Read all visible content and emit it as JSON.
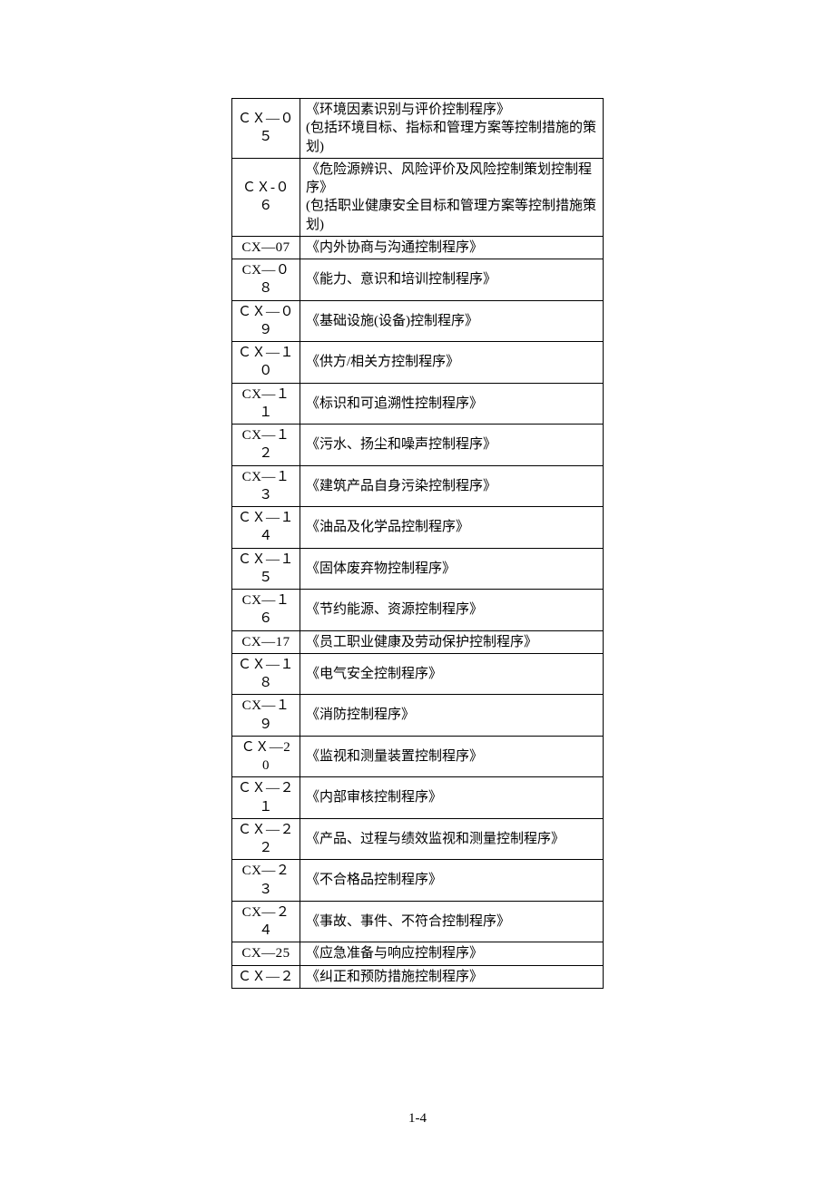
{
  "rows": [
    {
      "code": "ＣＸ—０５",
      "desc": "《环境因素识别与评价控制程序》\n(包括环境目标、指标和管理方案等控制措施的策划)"
    },
    {
      "code": "ＣＸ-０６",
      "desc": "《危险源辨识、风险评价及风险控制策划控制程序》\n(包括职业健康安全目标和管理方案等控制措施策划)"
    },
    {
      "code": "CX—07",
      "desc": "《内外协商与沟通控制程序》"
    },
    {
      "code": "CX—０８",
      "desc": "《能力、意识和培训控制程序》"
    },
    {
      "code": "ＣＸ—０９",
      "desc": "《基础设施(设备)控制程序》"
    },
    {
      "code": "ＣＸ—１０",
      "desc": "《供方/相关方控制程序》"
    },
    {
      "code": "CX—１１",
      "desc": "《标识和可追溯性控制程序》"
    },
    {
      "code": "CX—１２",
      "desc": "《污水、扬尘和噪声控制程序》"
    },
    {
      "code": "CX—１３",
      "desc": "《建筑产品自身污染控制程序》"
    },
    {
      "code": "ＣＸ—１４",
      "desc": "《油品及化学品控制程序》"
    },
    {
      "code": "ＣＸ—１５",
      "desc": "《固体废弃物控制程序》"
    },
    {
      "code": "CX—１６",
      "desc": "《节约能源、资源控制程序》"
    },
    {
      "code": "CX—17",
      "desc": "《员工职业健康及劳动保护控制程序》"
    },
    {
      "code": "ＣＸ—１８",
      "desc": "《电气安全控制程序》"
    },
    {
      "code": "CX—１９",
      "desc": "《消防控制程序》"
    },
    {
      "code": "ＣＸ—20",
      "desc": "《监视和测量装置控制程序》"
    },
    {
      "code": "ＣＸ—２１",
      "desc": "《内部审核控制程序》"
    },
    {
      "code": "ＣＸ—２２",
      "desc": "《产品、过程与绩效监视和测量控制程序》"
    },
    {
      "code": "CX—２３",
      "desc": "《不合格品控制程序》"
    },
    {
      "code": "CX—２４",
      "desc": "《事故、事件、不符合控制程序》"
    },
    {
      "code": "CX—25",
      "desc": "《应急准备与响应控制程序》"
    },
    {
      "code": "ＣＸ—２",
      "desc": "《纠正和预防措施控制程序》"
    }
  ],
  "footer": "1-4"
}
